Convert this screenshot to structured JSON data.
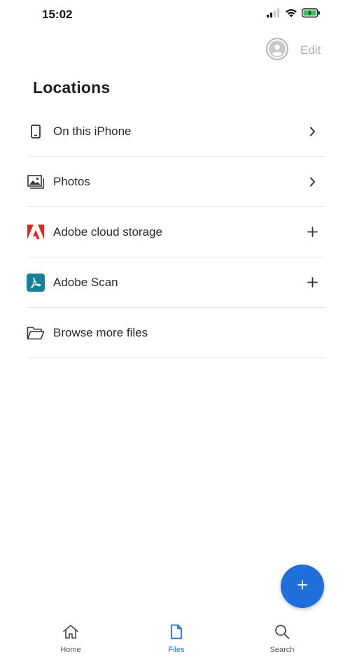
{
  "status_bar": {
    "time": "15:02",
    "icons": [
      "signal-icon",
      "wifi-icon",
      "battery-charging-icon"
    ]
  },
  "top_bar": {
    "avatar_icon": "user-avatar-icon",
    "edit_label": "Edit"
  },
  "section": {
    "title": "Locations"
  },
  "locations": [
    {
      "label": "On this iPhone",
      "icon": "phone-icon",
      "trailing": "chevron-right-icon"
    },
    {
      "label": "Photos",
      "icon": "photos-icon",
      "trailing": "chevron-right-icon"
    },
    {
      "label": "Adobe cloud storage",
      "icon": "adobe-logo-icon",
      "trailing": "plus-icon"
    },
    {
      "label": "Adobe Scan",
      "icon": "adobe-scan-icon",
      "trailing": "plus-icon"
    },
    {
      "label": "Browse more files",
      "icon": "folder-icon",
      "trailing": ""
    }
  ],
  "fab": {
    "icon": "plus-icon"
  },
  "tab_bar": {
    "tabs": [
      {
        "label": "Home",
        "icon": "home-icon",
        "active": false
      },
      {
        "label": "Files",
        "icon": "file-icon",
        "active": true
      },
      {
        "label": "Search",
        "icon": "search-icon",
        "active": false
      }
    ]
  },
  "colors": {
    "accent": "#1e6fdc",
    "adobe_red": "#e0261b",
    "adobe_scan_teal": "#15819a",
    "divider": "#e4e4e4",
    "muted_text": "#a9a9a9"
  }
}
